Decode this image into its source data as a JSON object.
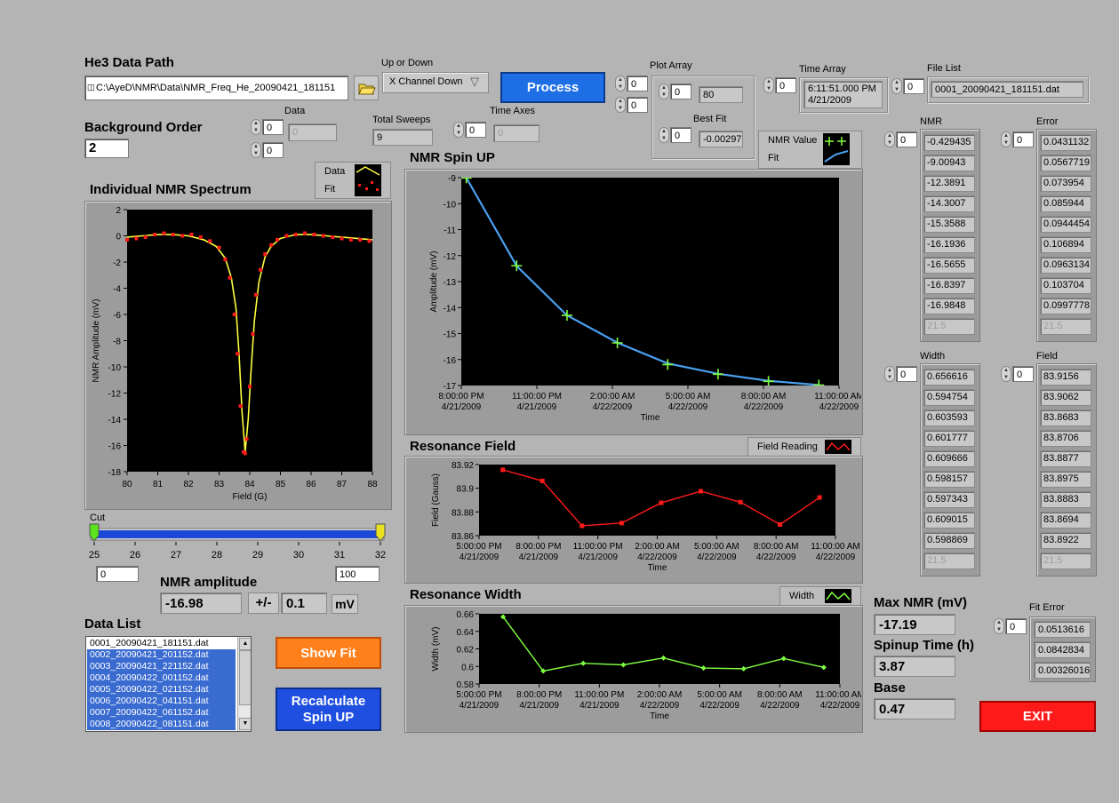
{
  "he3_path": {
    "label": "He3 Data Path",
    "value": "C:\\AyeD\\NMR\\Data\\NMR_Freq_He_20090421_181151"
  },
  "up_down": {
    "label": "Up or Down",
    "value": "X Channel Down"
  },
  "process_button": "Process",
  "plot_array": {
    "label": "Plot Array",
    "idx1": "0",
    "idx2": "0",
    "inner_idx": "0",
    "value": "80",
    "best_fit_label": "Best Fit",
    "best_fit_idx": "0",
    "best_fit_value": "-0.00297"
  },
  "time_array": {
    "label": "Time Array",
    "idx": "0",
    "value_line1": "6:11:51.000 PM",
    "value_line2": "4/21/2009"
  },
  "file_list": {
    "label": "File List",
    "idx": "0",
    "value": "0001_20090421_181151.dat"
  },
  "background_order": {
    "label": "Background Order",
    "value": "2"
  },
  "data_array": {
    "label": "Data",
    "idx1": "0",
    "idx2": "0",
    "value": "0"
  },
  "total_sweeps": {
    "label": "Total Sweeps",
    "value": "9"
  },
  "time_axes": {
    "label": "Time Axes",
    "idx": "0",
    "value": "0"
  },
  "spectrum_chart": {
    "title": "Individual NMR Spectrum",
    "legend": [
      "Data",
      "Fit"
    ],
    "ylabel": "NMR Amplitude (mV)",
    "xlabel": "Field (G)",
    "yticks": [
      "2",
      "0",
      "-2",
      "-4",
      "-6",
      "-8",
      "-10",
      "-12",
      "-14",
      "-16",
      "-18"
    ],
    "xticks": [
      "80",
      "81",
      "82",
      "83",
      "84",
      "85",
      "86",
      "87",
      "88"
    ]
  },
  "cut_slider": {
    "label": "Cut",
    "ticks": [
      "25",
      "26",
      "27",
      "28",
      "29",
      "30",
      "31",
      "32"
    ],
    "min": "0",
    "max": "100",
    "low_value": 25,
    "high_value": 32
  },
  "nmr_amplitude": {
    "label": "NMR amplitude",
    "value": "-16.98",
    "pm": "+/-",
    "error": "0.1",
    "unit": "mV"
  },
  "data_list": {
    "label": "Data List",
    "items": [
      {
        "name": "0001_20090421_181151.dat",
        "selected": false
      },
      {
        "name": "0002_20090421_201152.dat",
        "selected": true
      },
      {
        "name": "0003_20090421_221152.dat",
        "selected": true
      },
      {
        "name": "0004_20090422_001152.dat",
        "selected": true
      },
      {
        "name": "0005_20090422_021152.dat",
        "selected": true
      },
      {
        "name": "0006_20090422_041151.dat",
        "selected": true
      },
      {
        "name": "0007_20090422_061152.dat",
        "selected": true
      },
      {
        "name": "0008_20090422_081151.dat",
        "selected": true
      }
    ]
  },
  "show_fit_button": "Show Fit",
  "recalc_button": {
    "line1": "Recalculate",
    "line2": "Spin UP"
  },
  "spinup_chart": {
    "title": "NMR Spin UP",
    "legend": [
      "NMR Value",
      "Fit"
    ],
    "ylabel": "Amplitude (mV)",
    "xlabel": "Time",
    "yticks": [
      "-9",
      "-10",
      "-11",
      "-12",
      "-13",
      "-14",
      "-15",
      "-16",
      "-17"
    ],
    "xticks": [
      [
        "8:00:00 PM",
        "4/21/2009"
      ],
      [
        "11:00:00 PM",
        "4/21/2009"
      ],
      [
        "2:00:00 AM",
        "4/22/2009"
      ],
      [
        "5:00:00 AM",
        "4/22/2009"
      ],
      [
        "8:00:00 AM",
        "4/22/2009"
      ],
      [
        "11:00:00 AM",
        "4/22/2009"
      ]
    ]
  },
  "field_chart": {
    "title": "Resonance Field",
    "legend": [
      "Field Reading"
    ],
    "ylabel": "Field (Gauss)",
    "xlabel": "Time",
    "yticks": [
      "83.92",
      "83.9",
      "83.88",
      "83.86"
    ],
    "xticks": [
      [
        "5:00:00 PM",
        "4/21/2009"
      ],
      [
        "8:00:00 PM",
        "4/21/2009"
      ],
      [
        "11:00:00 PM",
        "4/21/2009"
      ],
      [
        "2:00:00 AM",
        "4/22/2009"
      ],
      [
        "5:00:00 AM",
        "4/22/2009"
      ],
      [
        "8:00:00 AM",
        "4/22/2009"
      ],
      [
        "11:00:00 AM",
        "4/22/2009"
      ]
    ]
  },
  "width_chart": {
    "title": "Resonance Width",
    "legend": [
      "Width"
    ],
    "ylabel": "Width (mV)",
    "xlabel": "Time",
    "yticks": [
      "0.66",
      "0.64",
      "0.62",
      "0.6",
      "0.58"
    ],
    "xticks": [
      [
        "5:00:00 PM",
        "4/21/2009"
      ],
      [
        "8:00:00 PM",
        "4/21/2009"
      ],
      [
        "11:00:00 PM",
        "4/21/2009"
      ],
      [
        "2:00:00 AM",
        "4/22/2009"
      ],
      [
        "5:00:00 AM",
        "4/22/2009"
      ],
      [
        "8:00:00 AM",
        "4/22/2009"
      ],
      [
        "11:00:00 AM",
        "4/22/2009"
      ]
    ]
  },
  "nmr_col": {
    "label": "NMR",
    "idx": "0",
    "values": [
      "-0.429435",
      "-9.00943",
      "-12.3891",
      "-14.3007",
      "-15.3588",
      "-16.1936",
      "-16.5655",
      "-16.8397",
      "-16.9848"
    ],
    "dim": "21.5"
  },
  "error_col": {
    "label": "Error",
    "idx": "0",
    "values": [
      "0.0431132",
      "0.0567719",
      "0.073954",
      "0.085944",
      "0.0944454",
      "0.106894",
      "0.0963134",
      "0.103704",
      "0.0997778"
    ],
    "dim": "21.5"
  },
  "width_col": {
    "label": "Width",
    "idx": "0",
    "values": [
      "0.656616",
      "0.594754",
      "0.603593",
      "0.601777",
      "0.609666",
      "0.598157",
      "0.597343",
      "0.609015",
      "0.598869"
    ],
    "dim": "21.5"
  },
  "field_col": {
    "label": "Field",
    "idx": "0",
    "values": [
      "83.9156",
      "83.9062",
      "83.8683",
      "83.8706",
      "83.8877",
      "83.8975",
      "83.8883",
      "83.8694",
      "83.8922"
    ],
    "dim": "21.5"
  },
  "max_nmr": {
    "label": "Max NMR (mV)",
    "value": "-17.19"
  },
  "spinup_time": {
    "label": "Spinup Time (h)",
    "value": "3.87"
  },
  "base": {
    "label": "Base",
    "value": "0.47"
  },
  "fit_error": {
    "label": "Fit Error",
    "idx": "0",
    "values": [
      "0.0513616",
      "0.0842834",
      "0.00326016"
    ]
  },
  "exit_button": "EXIT",
  "colors": {
    "data_red": "#ff1a1a",
    "fit_yellow": "#ffff40",
    "nmr_green": "#80ff40",
    "fit_blue": "#4aa0f0",
    "process_blue": "#1e6fe6",
    "fit_orange": "#ff7f1a",
    "exit_red": "#ff1a1a"
  },
  "chart_data": [
    {
      "type": "line",
      "title": "Individual NMR Spectrum",
      "xlabel": "Field (G)",
      "ylabel": "NMR Amplitude (mV)",
      "xlim": [
        80,
        88
      ],
      "ylim": [
        -18,
        2
      ],
      "series": [
        {
          "name": "Data",
          "style": "scatter",
          "x": [
            80.0,
            80.3,
            80.6,
            80.9,
            81.2,
            81.5,
            81.8,
            82.1,
            82.4,
            82.7,
            83.0,
            83.2,
            83.35,
            83.5,
            83.6,
            83.7,
            83.8,
            83.85,
            83.9,
            84.0,
            84.1,
            84.2,
            84.35,
            84.5,
            84.7,
            84.9,
            85.2,
            85.5,
            85.8,
            86.1,
            86.4,
            86.7,
            87.0,
            87.3,
            87.6,
            87.9
          ],
          "y": [
            -0.3,
            -0.2,
            -0.1,
            0.1,
            0.2,
            0.1,
            0.0,
            0.1,
            -0.1,
            -0.4,
            -0.9,
            -1.8,
            -3.2,
            -6.0,
            -9.0,
            -13.0,
            -16.5,
            -16.6,
            -15.5,
            -11.5,
            -7.5,
            -4.5,
            -2.6,
            -1.4,
            -0.7,
            -0.3,
            0.0,
            0.1,
            0.2,
            0.1,
            0.0,
            -0.1,
            -0.2,
            -0.3,
            -0.3,
            -0.4
          ]
        },
        {
          "name": "Fit",
          "style": "line",
          "x": [
            80.0,
            80.5,
            81.0,
            81.5,
            82.0,
            82.5,
            82.9,
            83.2,
            83.4,
            83.55,
            83.65,
            83.75,
            83.85,
            83.95,
            84.05,
            84.15,
            84.3,
            84.5,
            84.7,
            85.0,
            85.5,
            86.0,
            86.5,
            87.0,
            87.5,
            88.0
          ],
          "y": [
            -0.1,
            0.0,
            0.1,
            0.1,
            0.0,
            -0.3,
            -0.8,
            -1.7,
            -3.2,
            -5.5,
            -9.0,
            -13.5,
            -16.5,
            -14.0,
            -10.0,
            -6.5,
            -3.5,
            -1.6,
            -0.8,
            -0.2,
            0.1,
            0.1,
            0.0,
            -0.1,
            -0.2,
            -0.3
          ]
        }
      ]
    },
    {
      "type": "line",
      "title": "NMR Spin UP",
      "xlabel": "Time",
      "ylabel": "Amplitude (mV)",
      "ylim": [
        -17,
        -9
      ],
      "series": [
        {
          "name": "NMR Value",
          "x": [
            "4/21/2009 6:11:51 PM",
            "4/21/2009 8:11:52 PM",
            "4/21/2009 10:11:52 PM",
            "4/22/2009 12:11:52 AM",
            "4/22/2009 2:11:52 AM",
            "4/22/2009 4:11:51 AM",
            "4/22/2009 6:11:52 AM",
            "4/22/2009 8:11:51 AM",
            "4/22/2009 10:11:51 AM"
          ],
          "y": [
            -0.429435,
            -9.00943,
            -12.3891,
            -14.3007,
            -15.3588,
            -16.1936,
            -16.5655,
            -16.8397,
            -16.9848
          ]
        },
        {
          "name": "Fit",
          "x": [
            "4/21/2009 8:11:52 PM",
            "4/21/2009 10:11:52 PM",
            "4/22/2009 12:11:52 AM",
            "4/22/2009 2:11:52 AM",
            "4/22/2009 4:11:51 AM",
            "4/22/2009 6:11:52 AM",
            "4/22/2009 8:11:51 AM",
            "4/22/2009 10:11:51 AM"
          ],
          "y": [
            -9.0,
            -12.4,
            -14.3,
            -15.35,
            -16.15,
            -16.55,
            -16.82,
            -16.98
          ]
        }
      ]
    },
    {
      "type": "line",
      "title": "Resonance Field",
      "xlabel": "Time",
      "ylabel": "Field (Gauss)",
      "ylim": [
        83.86,
        83.92
      ],
      "series": [
        {
          "name": "Field Reading",
          "x": [
            "4/21/2009 6:11:51 PM",
            "4/21/2009 8:11:52 PM",
            "4/21/2009 10:11:52 PM",
            "4/22/2009 12:11:52 AM",
            "4/22/2009 2:11:52 AM",
            "4/22/2009 4:11:51 AM",
            "4/22/2009 6:11:52 AM",
            "4/22/2009 8:11:51 AM",
            "4/22/2009 10:11:51 AM"
          ],
          "y": [
            83.9156,
            83.9062,
            83.8683,
            83.8706,
            83.8877,
            83.8975,
            83.8883,
            83.8694,
            83.8922
          ]
        }
      ]
    },
    {
      "type": "line",
      "title": "Resonance Width",
      "xlabel": "Time",
      "ylabel": "Width (mV)",
      "ylim": [
        0.58,
        0.66
      ],
      "series": [
        {
          "name": "Width",
          "x": [
            "4/21/2009 6:11:51 PM",
            "4/21/2009 8:11:52 PM",
            "4/21/2009 10:11:52 PM",
            "4/22/2009 12:11:52 AM",
            "4/22/2009 2:11:52 AM",
            "4/22/2009 4:11:51 AM",
            "4/22/2009 6:11:52 AM",
            "4/22/2009 8:11:51 AM",
            "4/22/2009 10:11:51 AM"
          ],
          "y": [
            0.656616,
            0.594754,
            0.603593,
            0.601777,
            0.609666,
            0.598157,
            0.597343,
            0.609015,
            0.598869
          ]
        }
      ]
    }
  ]
}
